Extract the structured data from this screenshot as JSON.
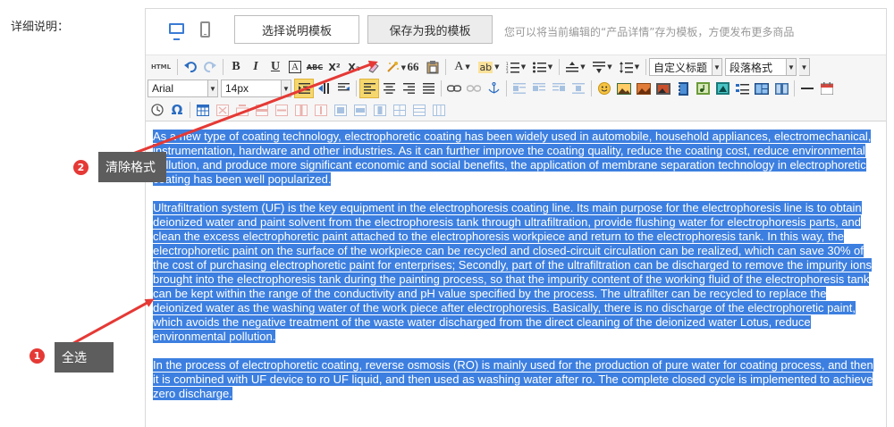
{
  "field": {
    "label": "详细说明："
  },
  "top_bar": {
    "template_button": "选择说明模板",
    "save_button": "保存为我的模板",
    "tip_text": "您可以将当前编辑的“产品详情”存为模板，方便发布更多商品"
  },
  "toolbar": {
    "font_family": "Arial",
    "font_size": "14px",
    "heading_select": "自定义标题",
    "paragraph_select": "段落格式",
    "row1_icons": [
      "html-source-icon",
      "undo-icon",
      "redo-icon",
      "bold-icon",
      "italic-icon",
      "underline-icon",
      "font-border-icon",
      "strikethrough-icon",
      "superscript-icon",
      "subscript-icon",
      "remove-format-icon",
      "auto-typeset-icon",
      "blockquote-icon",
      "paste-text-icon",
      "font-color-icon",
      "background-color-icon",
      "ordered-list-icon",
      "unordered-list-icon",
      "row-spacing-top-icon",
      "row-spacing-bottom-icon",
      "line-height-icon"
    ],
    "labels": {
      "html": "HTML",
      "bold": "B",
      "italic": "I",
      "underline": "U",
      "border": "A",
      "strike": "ABC",
      "superscript": "X²",
      "subscript": "X₂",
      "quote": "66",
      "font_color": "A",
      "bg_color": "ab",
      "omega": "Ω"
    },
    "accent_color": "#3c7fe0"
  },
  "content": {
    "paragraphs": [
      "As a new type of coating technology, electrophoretic coating has been widely used in automobile, household appliances, electromechanical, instrumentation, hardware and other industries. As it can further improve the coating quality, reduce the coating cost, reduce environmental pollution, and produce more significant economic and social benefits, the application of membrane separation technology in electrophoretic coating has been well popularized.",
      "Ultrafiltration system (UF) is the key equipment in the electrophoresis coating line. Its main purpose for the electrophoresis line is to obtain deionized water and paint solvent from the electrophoresis tank through ultrafiltration, provide flushing water for electrophoresis parts, and clean the excess electrophoretic paint attached to the electrophoresis workpiece and return to the electrophoresis tank. In this way, the electrophoretic paint on the surface of the workpiece can be recycled and closed-circuit circulation can be realized, which can save 30% of the cost of purchasing electrophoretic paint for enterprises; Secondly, part of the ultrafiltration can be discharged to remove the impurity ions brought into the electrophoresis tank during the painting process, so that the impurity content of the working fluid of the electrophoresis tank can be kept within the range of the conductivity and pH value specified by the process. The ultrafilter can be recycled to replace the deionized water as the washing water of the work piece after electrophoresis. Basically, there is no discharge of the electrophoretic paint, which avoids the negative treatment of the waste water discharged from the direct cleaning of the deionized water Lotus, reduce environmental pollution.",
      "In the process of electrophoretic coating, reverse osmosis (RO) is mainly used for the production of pure water for coating process, and then it is combined with UF device to ro UF liquid, and then used as washing water after ro. The complete closed cycle is implemented to achieve zero discharge."
    ],
    "selection_color": "#3c7fe0"
  },
  "annotations": [
    {
      "number": "1",
      "text": "全选"
    },
    {
      "number": "2",
      "text": "清除格式"
    }
  ],
  "annotation_arrow_color": "#e53935"
}
